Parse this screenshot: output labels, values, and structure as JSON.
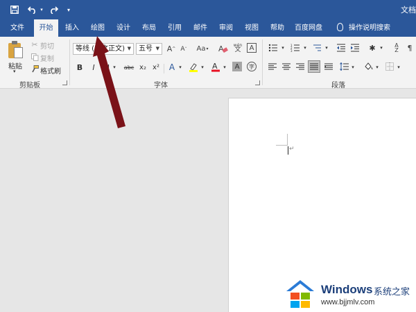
{
  "window": {
    "title": "文档"
  },
  "quick_access": {
    "save": "save-icon",
    "undo": "undo-icon",
    "redo": "redo-icon",
    "customize": "▾"
  },
  "tabs": [
    "文件",
    "开始",
    "插入",
    "绘图",
    "设计",
    "布局",
    "引用",
    "邮件",
    "审阅",
    "视图",
    "帮助",
    "百度网盘"
  ],
  "active_tab": "开始",
  "tell_me": {
    "label": "操作说明搜索"
  },
  "clipboard": {
    "group_label": "剪贴板",
    "paste": "粘贴",
    "cut": "剪切",
    "copy": "复制",
    "format_painter": "格式刷"
  },
  "font": {
    "group_label": "字体",
    "name": "等线 (中文正文)",
    "size": "五号",
    "grow": "A",
    "shrink": "A",
    "change_case": "Aa",
    "phonetic": "wén",
    "border_char": "A",
    "bold": "B",
    "italic": "I",
    "underline": "U",
    "strike": "abc",
    "subscript": "x₂",
    "superscript": "x²",
    "highlight_color": "#ffff00",
    "font_color": "#e81123"
  },
  "paragraph": {
    "group_label": "段落"
  },
  "watermark": {
    "brand": "Windows",
    "cn": "系统之家",
    "url": "www.bjjmlv.com"
  },
  "colors": {
    "titlebar": "#2b579a",
    "ribbon": "#f3f3f3",
    "arrow": "#7a1218"
  }
}
